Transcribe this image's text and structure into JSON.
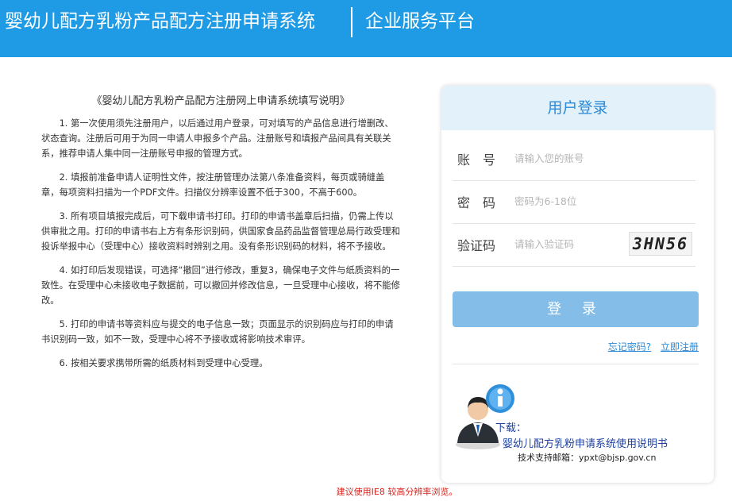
{
  "header": {
    "system_title": "婴幼儿配方乳粉产品配方注册申请系统",
    "platform": "企业服务平台"
  },
  "instructions": {
    "title": "《婴幼儿配方乳粉产品配方注册网上申请系统填写说明》",
    "items": [
      "1. 第一次使用须先注册用户，以后通过用户登录，可对填写的产品信息进行增删改、状态查询。注册后可用于为同一申请人申报多个产品。注册账号和填报产品间具有关联关系，推荐申请人集中同一注册账号申报的管理方式。",
      "2. 填报前准备申请人证明性文件，按注册管理办法第八条准备资料，每页或骑缝盖章，每项资料扫描为一个PDF文件。扫描仪分辨率设置不低于300，不高于600。",
      "3. 所有项目填报完成后，可下载申请书打印。打印的申请书盖章后扫描，仍需上传以供审批之用。打印的申请书右上方有条形识别码，供国家食品药品监督管理总局行政受理和投诉举报中心（受理中心）接收资料时辨别之用。没有条形识别码的材料，将不予接收。",
      "4. 如打印后发现错误，可选择“撤回”进行修改，重复3，确保电子文件与纸质资料的一致性。在受理中心未接收电子数据前，可以撤回并修改信息，一旦受理中心接收，将不能修改。",
      "5. 打印的申请书等资料应与提交的电子信息一致；页面显示的识别码应与打印的申请书识别码一致，如不一致，受理中心将不予接收或将影响技术审评。",
      "6. 按相关要求携带所需的纸质材料到受理中心受理。"
    ]
  },
  "login": {
    "title": "用户登录",
    "account_label": "账　号",
    "account_placeholder": "请输入您的账号",
    "password_label": "密　码",
    "password_placeholder": "密码为6-18位",
    "captcha_label": "验证码",
    "captcha_placeholder": "请输入验证码",
    "captcha_text": "3HN56",
    "login_button": "登 录",
    "forgot_password": "忘记密码?",
    "register": "立即注册",
    "download_label": "下载：",
    "manual_link": "婴幼儿配方乳粉申请系统使用说明书",
    "support": "技术支持邮箱：ypxt@bjsp.gov.cn"
  },
  "footer": {
    "note": "建议使用IE8 较高分辨率浏览。"
  },
  "colors": {
    "header_bg": "#1f9ae4",
    "panel_head_bg": "#e3f1fb",
    "accent": "#2a8ad8",
    "login_button_bg": "#84bde7",
    "footer_note": "#d9231d"
  }
}
